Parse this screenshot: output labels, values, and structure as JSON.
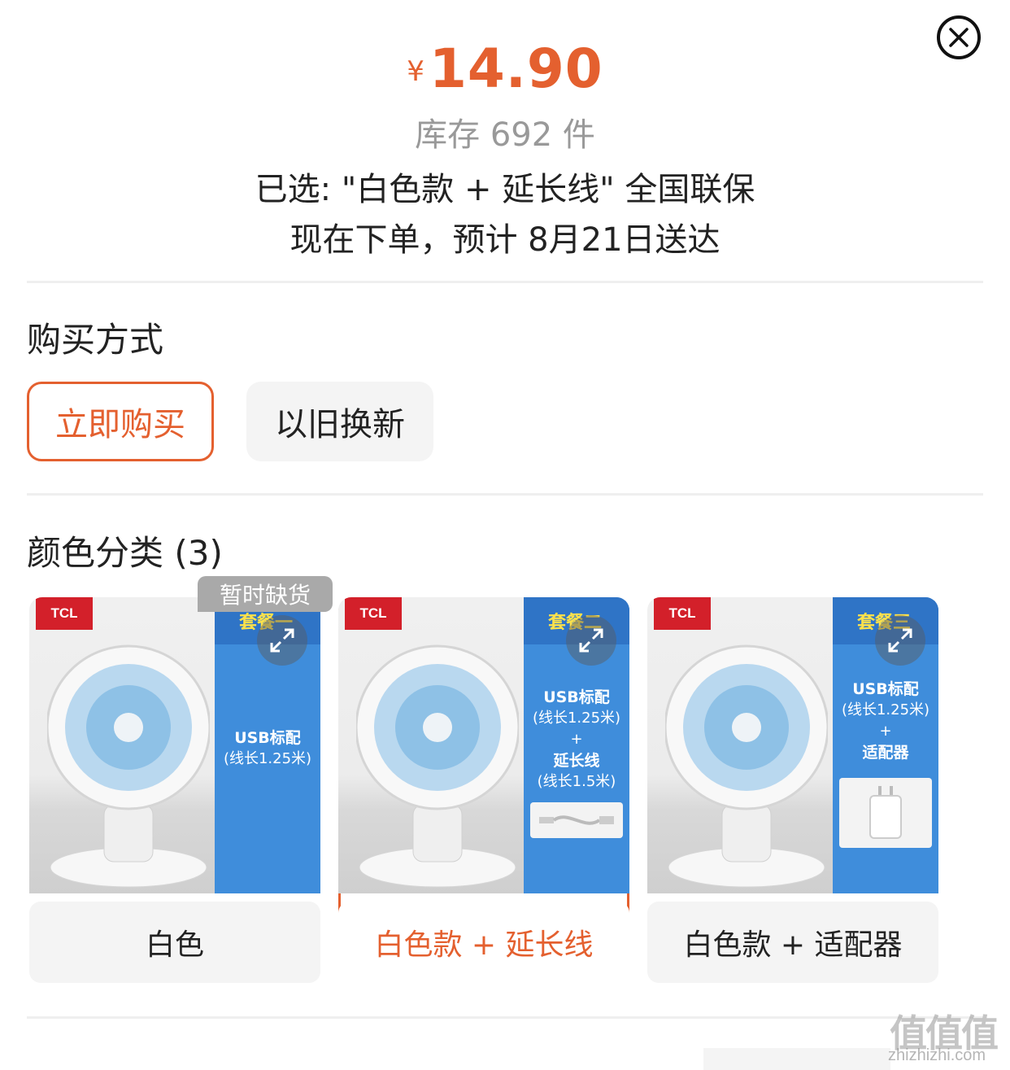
{
  "header": {
    "currency": "¥",
    "price": "14.90",
    "stock": "库存 692 件",
    "selected": "已选: \"白色款 + 延长线\" 全国联保",
    "delivery": "现在下单，预计 8月21日送达"
  },
  "purchase_method": {
    "title": "购买方式",
    "options": [
      {
        "label": "立即购买",
        "active": true
      },
      {
        "label": "以旧换新",
        "active": false
      }
    ]
  },
  "color_category": {
    "title": "颜色分类 (3)",
    "variants": [
      {
        "label": "白色",
        "selected": false,
        "out_of_stock_tag": "暂时缺货",
        "brand": "TCL",
        "package": "套餐一",
        "panel_lines": [
          "USB标配",
          "(线长1.25米)"
        ]
      },
      {
        "label": "白色款 + 延长线",
        "selected": true,
        "brand": "TCL",
        "package": "套餐二",
        "panel_lines": [
          "USB标配",
          "(线长1.25米)",
          "+",
          "延长线",
          "(线长1.5米)"
        ]
      },
      {
        "label": "白色款 + 适配器",
        "selected": false,
        "brand": "TCL",
        "package": "套餐三",
        "panel_lines": [
          "USB标配",
          "(线长1.25米)",
          "+",
          "适配器"
        ]
      }
    ]
  },
  "watermark": {
    "text": "值值值",
    "url": "zhizhizhi.com"
  },
  "next_section_peek": "",
  "colors": {
    "accent": "#e4602f",
    "panel_blue": "#3f8ddb",
    "muted": "#999999"
  }
}
